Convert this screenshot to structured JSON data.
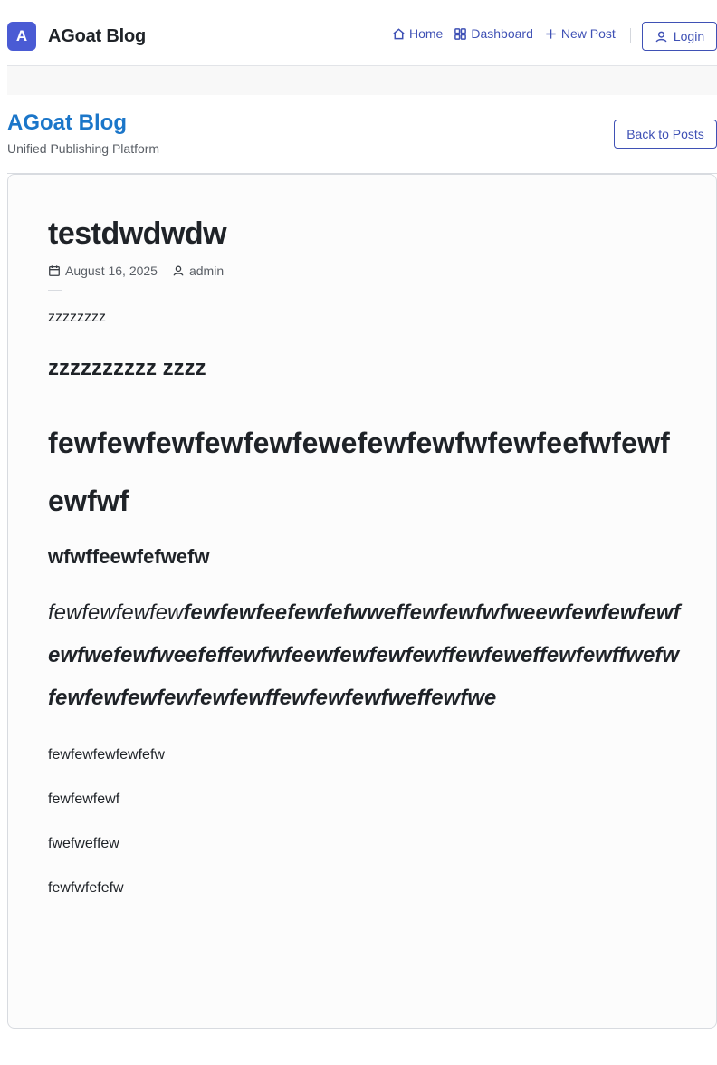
{
  "nav": {
    "logo_letter": "A",
    "brand": "AGoat Blog",
    "links": [
      {
        "label": "Home",
        "icon": "home-icon"
      },
      {
        "label": "Dashboard",
        "icon": "grid-icon"
      },
      {
        "label": "New Post",
        "icon": "plus-icon"
      }
    ],
    "login_label": "Login"
  },
  "header": {
    "title": "AGoat Blog",
    "subtitle": "Unified Publishing Platform",
    "back_label": "Back to Posts"
  },
  "post": {
    "title": "testdwdwdw",
    "date": "August 16, 2025",
    "author": "admin",
    "blocks": {
      "p1": "zzzzzzzz",
      "h2a": "zzzzzzzzzz zzzz",
      "h1a": "fewfewfewfewfewfewefewfewfwfewfeefwfewfewfwf",
      "h3a": "wfwffeewfefwefw",
      "h2b_light": "fewfewfewfew",
      "h2b_bold": "fewfewfeefewfefwweffewfewfwfweewfewfewfewfewfwefewfweefeffewfwfeewfewfewfewffewfeweffewfewffwefwfewfewfewfewfewfewffewfewfewfweffewfwe",
      "para1": "fewfewfewfewfefw",
      "para2": "fewfewfewf",
      "para3": "fwefweffew",
      "para4": "fewfwfefefw"
    }
  },
  "colors": {
    "accent": "#3f51b5",
    "logo_bg": "#4a5bd4",
    "site_title": "#1b76c9"
  }
}
